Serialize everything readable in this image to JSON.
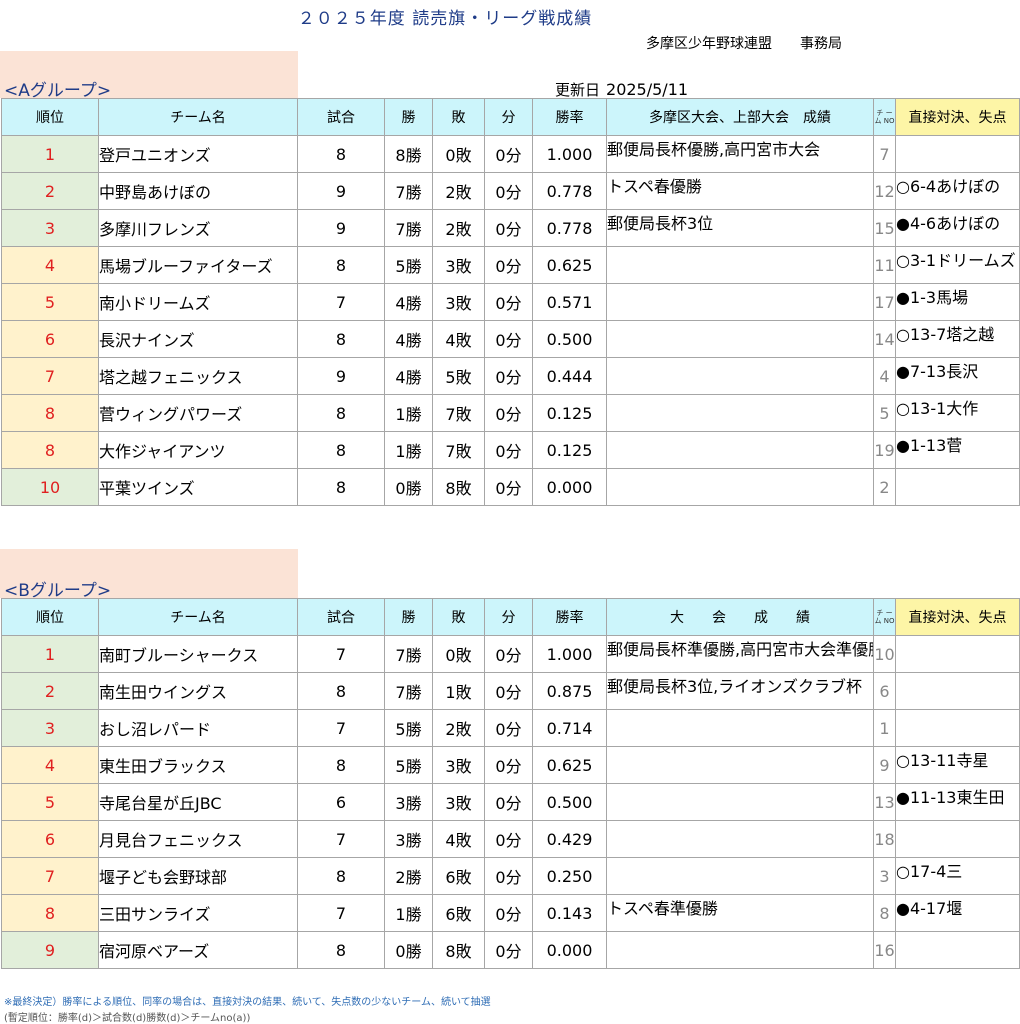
{
  "title": "２０２５年度 読売旗・リーグ戦成績",
  "organization": "多摩区少年野球連盟　　事務局",
  "updated": {
    "label": "更新日",
    "date": "2025/5/11"
  },
  "groupA": {
    "label": "<Aグループ>",
    "headers": {
      "rank": "順位",
      "team": "チーム名",
      "games": "試合",
      "wins": "勝",
      "losses": "敗",
      "draws": "分",
      "pct": "勝率",
      "results": "多摩区大会、上部大会　成績",
      "no": "チ ー ム NO",
      "h2h": "直接対決、失点"
    },
    "rows": [
      {
        "rank": "1",
        "team": "登戸ユニオンズ",
        "games": "8",
        "wins": "8勝",
        "losses": "0敗",
        "draws": "0分",
        "pct": "1.000",
        "results": "郵便局長杯優勝,高円宮市大会",
        "no": "7",
        "h2h": ""
      },
      {
        "rank": "2",
        "team": "中野島あけぼの",
        "games": "9",
        "wins": "7勝",
        "losses": "2敗",
        "draws": "0分",
        "pct": "0.778",
        "results": "トスペ春優勝",
        "no": "12",
        "h2h": "○6-4あけぼの"
      },
      {
        "rank": "3",
        "team": "多摩川フレンズ",
        "games": "9",
        "wins": "7勝",
        "losses": "2敗",
        "draws": "0分",
        "pct": "0.778",
        "results": "郵便局長杯3位",
        "no": "15",
        "h2h": "●4-6あけぼの"
      },
      {
        "rank": "4",
        "team": "馬場ブルーファイターズ",
        "games": "8",
        "wins": "5勝",
        "losses": "3敗",
        "draws": "0分",
        "pct": "0.625",
        "results": "",
        "no": "11",
        "h2h": "○3-1ドリームズ"
      },
      {
        "rank": "5",
        "team": "南小ドリームズ",
        "games": "7",
        "wins": "4勝",
        "losses": "3敗",
        "draws": "0分",
        "pct": "0.571",
        "results": "",
        "no": "17",
        "h2h": "●1-3馬場"
      },
      {
        "rank": "6",
        "team": "長沢ナインズ",
        "games": "8",
        "wins": "4勝",
        "losses": "4敗",
        "draws": "0分",
        "pct": "0.500",
        "results": "",
        "no": "14",
        "h2h": "○13-7塔之越"
      },
      {
        "rank": "7",
        "team": "塔之越フェニックス",
        "games": "9",
        "wins": "4勝",
        "losses": "5敗",
        "draws": "0分",
        "pct": "0.444",
        "results": "",
        "no": "4",
        "h2h": "●7-13長沢"
      },
      {
        "rank": "8",
        "team": "菅ウィングパワーズ",
        "games": "8",
        "wins": "1勝",
        "losses": "7敗",
        "draws": "0分",
        "pct": "0.125",
        "results": "",
        "no": "5",
        "h2h": "○13-1大作"
      },
      {
        "rank": "8",
        "team": "大作ジャイアンツ",
        "games": "8",
        "wins": "1勝",
        "losses": "7敗",
        "draws": "0分",
        "pct": "0.125",
        "results": "",
        "no": "19",
        "h2h": "●1-13菅"
      },
      {
        "rank": "10",
        "team": "平葉ツインズ",
        "games": "8",
        "wins": "0勝",
        "losses": "8敗",
        "draws": "0分",
        "pct": "0.000",
        "results": "",
        "no": "2",
        "h2h": ""
      }
    ]
  },
  "groupB": {
    "label": "<Bグループ>",
    "headers": {
      "rank": "順位",
      "team": "チーム名",
      "games": "試合",
      "wins": "勝",
      "losses": "敗",
      "draws": "分",
      "pct": "勝率",
      "results": "大　　会　　成　　績",
      "no": "チ ー ム NO",
      "h2h": "直接対決、失点"
    },
    "rows": [
      {
        "rank": "1",
        "team": "南町ブルーシャークス",
        "games": "7",
        "wins": "7勝",
        "losses": "0敗",
        "draws": "0分",
        "pct": "1.000",
        "results": "郵便局長杯準優勝,高円宮市大会準優勝",
        "no": "10",
        "h2h": ""
      },
      {
        "rank": "2",
        "team": "南生田ウイングス",
        "games": "8",
        "wins": "7勝",
        "losses": "1敗",
        "draws": "0分",
        "pct": "0.875",
        "results": "郵便局長杯3位,ライオンズクラブ杯",
        "no": "6",
        "h2h": ""
      },
      {
        "rank": "3",
        "team": "おし沼レパード",
        "games": "7",
        "wins": "5勝",
        "losses": "2敗",
        "draws": "0分",
        "pct": "0.714",
        "results": "",
        "no": "1",
        "h2h": ""
      },
      {
        "rank": "4",
        "team": "東生田ブラックス",
        "games": "8",
        "wins": "5勝",
        "losses": "3敗",
        "draws": "0分",
        "pct": "0.625",
        "results": "",
        "no": "9",
        "h2h": "○13-11寺星"
      },
      {
        "rank": "5",
        "team": "寺尾台星が丘JBC",
        "games": "6",
        "wins": "3勝",
        "losses": "3敗",
        "draws": "0分",
        "pct": "0.500",
        "results": "",
        "no": "13",
        "h2h": "●11-13東生田"
      },
      {
        "rank": "6",
        "team": "月見台フェニックス",
        "games": "7",
        "wins": "3勝",
        "losses": "4敗",
        "draws": "0分",
        "pct": "0.429",
        "results": "",
        "no": "18",
        "h2h": ""
      },
      {
        "rank": "7",
        "team": "堰子ども会野球部",
        "games": "8",
        "wins": "2勝",
        "losses": "6敗",
        "draws": "0分",
        "pct": "0.250",
        "results": "",
        "no": "3",
        "h2h": "○17-4三"
      },
      {
        "rank": "8",
        "team": "三田サンライズ",
        "games": "7",
        "wins": "1勝",
        "losses": "6敗",
        "draws": "0分",
        "pct": "0.143",
        "results": "トスペ春準優勝",
        "no": "8",
        "h2h": "●4-17堰"
      },
      {
        "rank": "9",
        "team": "宿河原ベアーズ",
        "games": "8",
        "wins": "0勝",
        "losses": "8敗",
        "draws": "0分",
        "pct": "0.000",
        "results": "",
        "no": "16",
        "h2h": ""
      }
    ]
  },
  "footnotes": [
    "※最終決定）勝率による順位、同率の場合は、直接対決の結果、続いて、失点数の少ないチーム、続いて抽選",
    "(暫定順位：勝率(d)＞試合数(d)勝数(d)＞チームno(a))"
  ]
}
